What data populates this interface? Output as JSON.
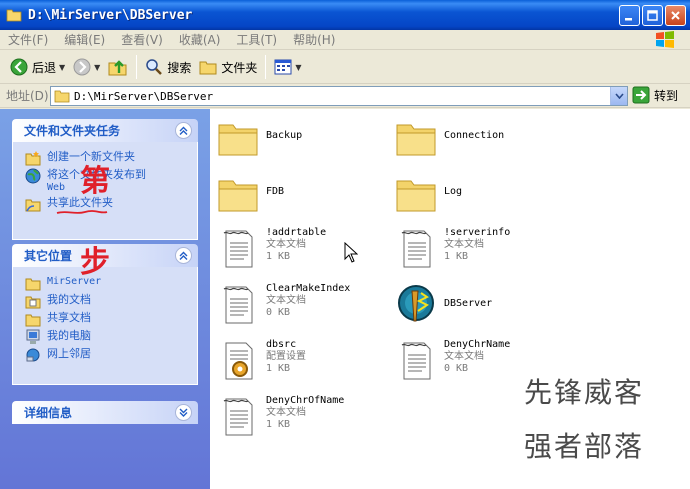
{
  "window": {
    "title": "D:\\MirServer\\DBServer"
  },
  "menu": [
    "文件(F)",
    "编辑(E)",
    "查看(V)",
    "收藏(A)",
    "工具(T)",
    "帮助(H)"
  ],
  "toolbar": {
    "back": "后退",
    "search": "搜索",
    "folders": "文件夹"
  },
  "address": {
    "label": "地址(D)",
    "value": "D:\\MirServer\\DBServer",
    "go": "转到"
  },
  "tasks": {
    "title": "文件和文件夹任务",
    "items": [
      "创建一个新文件夹",
      "将这个文件夹发布到",
      "Web",
      "共享此文件夹"
    ]
  },
  "places": {
    "title": "其它位置",
    "items": [
      "MirServer",
      "我的文档",
      "共享文档",
      "我的电脑",
      "网上邻居"
    ]
  },
  "details": {
    "title": "详细信息"
  },
  "overlay": {
    "char1": "第",
    "char2": "步"
  },
  "files": [
    {
      "name": "Backup"
    },
    {
      "name": "Connection"
    },
    {
      "name": "FDB"
    },
    {
      "name": "Log"
    },
    {
      "name": "!addrtable",
      "type": "文本文档",
      "size": "1 KB"
    },
    {
      "name": "!serverinfo",
      "type": "文本文档",
      "size": "1 KB"
    },
    {
      "name": "ClearMakeIndex",
      "type": "文本文档",
      "size": "0 KB"
    },
    {
      "name": "DBServer"
    },
    {
      "name": "dbsrc",
      "type": "配置设置",
      "size": "1 KB"
    },
    {
      "name": "DenyChrName",
      "type": "文本文档",
      "size": "0 KB"
    },
    {
      "name": "DenyChrOfName",
      "type": "文本文档",
      "size": "1 KB"
    }
  ],
  "watermark": {
    "line1": "先锋威客",
    "line2": "强者部落"
  },
  "colors": {
    "title_bar": "#0a55d3",
    "left_pane": "#6375d6",
    "link": "#215dc6",
    "overlay_red": "#e0202a"
  }
}
